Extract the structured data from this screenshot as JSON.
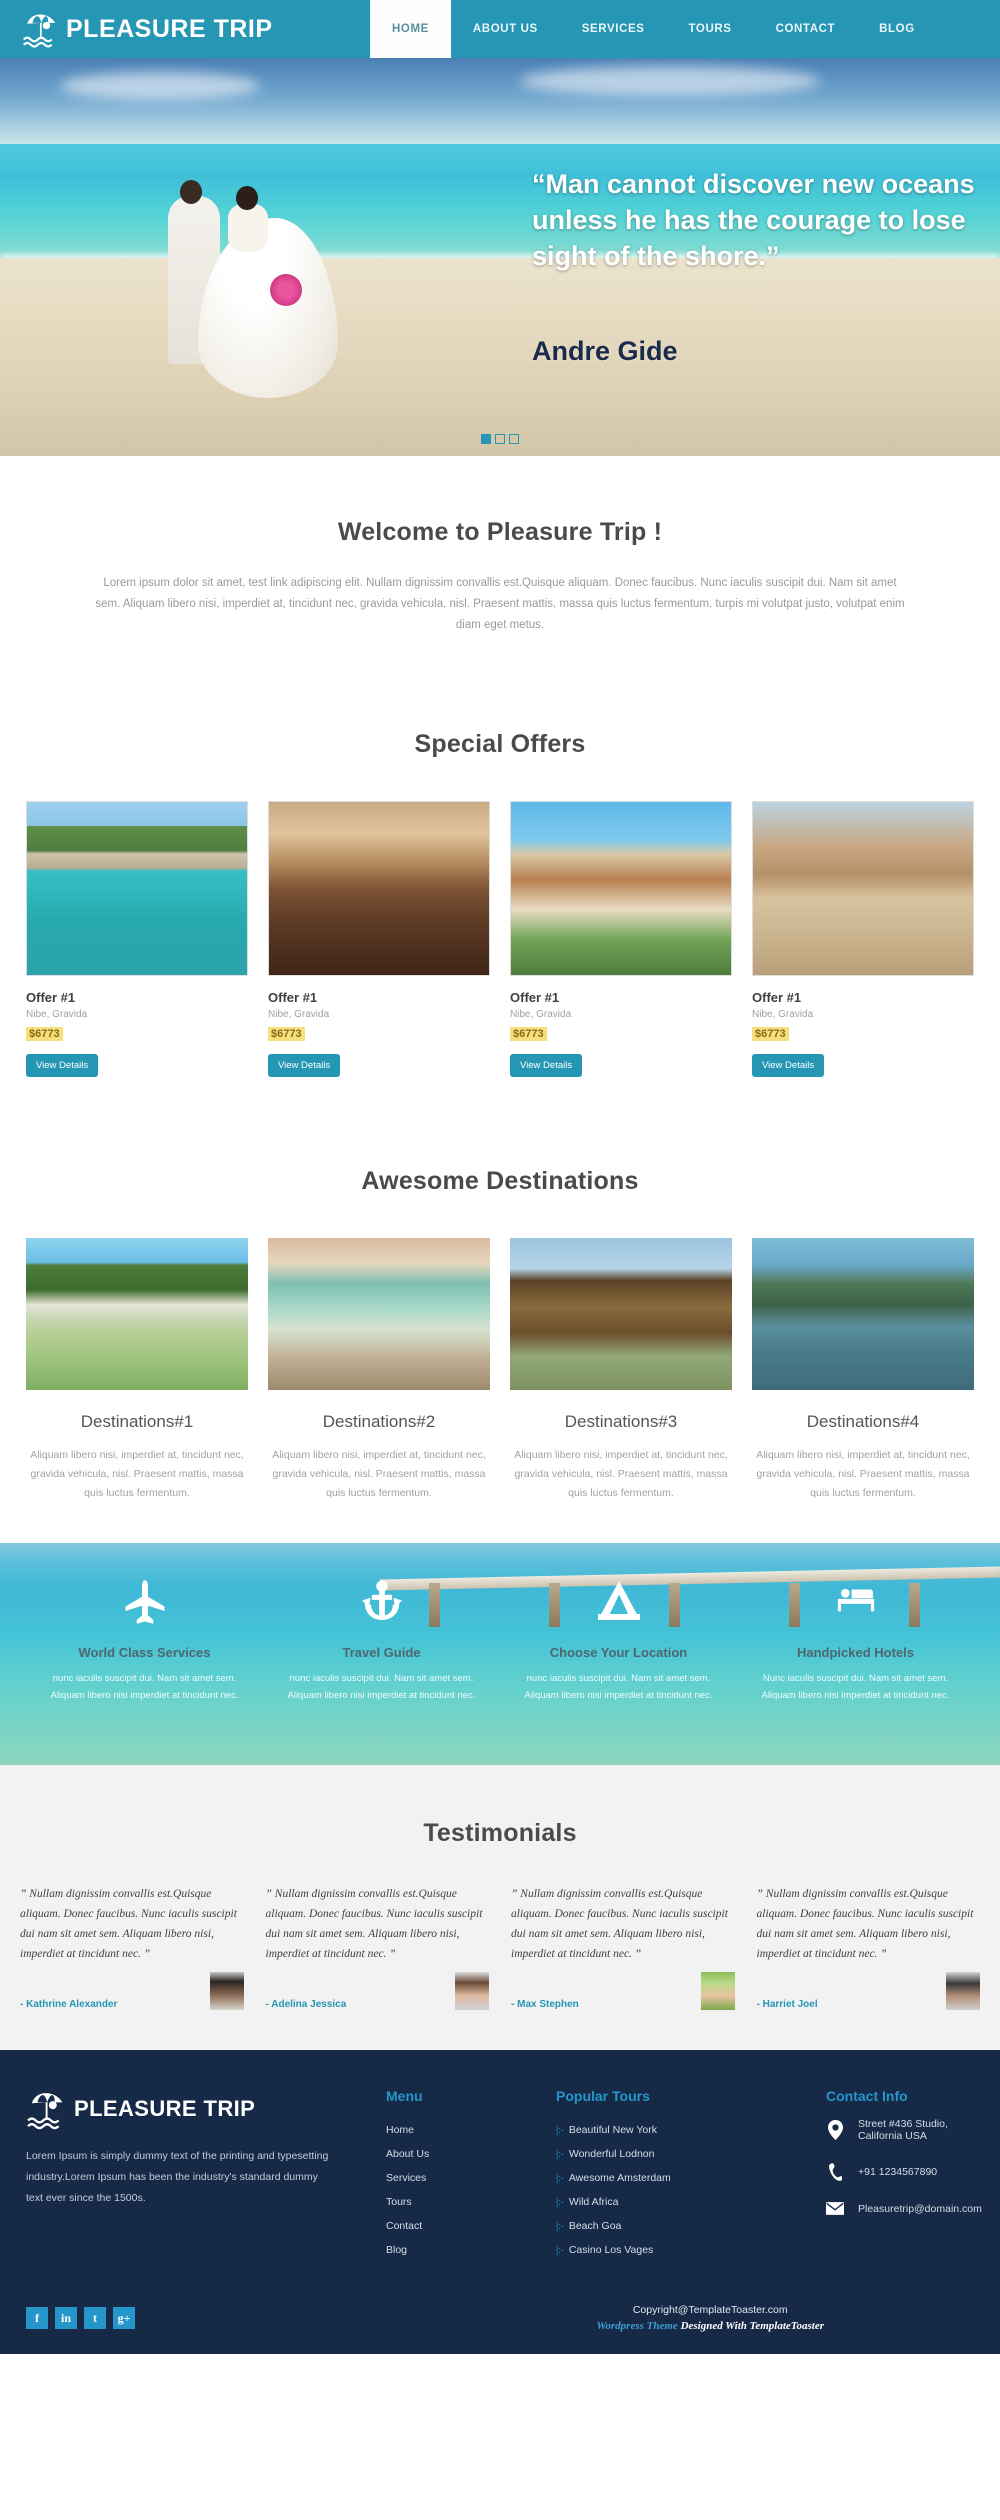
{
  "brand": {
    "name": "PLEASURE TRIP",
    "logo_icon": "beach-umbrella-icon"
  },
  "nav": {
    "items": [
      {
        "label": "HOME",
        "active": true
      },
      {
        "label": "ABOUT US",
        "active": false
      },
      {
        "label": "SERVICES",
        "active": false
      },
      {
        "label": "TOURS",
        "active": false
      },
      {
        "label": "CONTACT",
        "active": false
      },
      {
        "label": "BLOG",
        "active": false
      }
    ]
  },
  "hero": {
    "quote": "“Man cannot discover new oceans unless he has the courage to lose sight of the shore.”",
    "author": "Andre Gide",
    "slides": [
      {
        "active": true
      },
      {
        "active": false
      },
      {
        "active": false
      }
    ]
  },
  "welcome": {
    "title": "Welcome to Pleasure Trip !",
    "text": "Lorem ipsum dolor sit amet, test link adipiscing elit. Nullam dignissim convallis est.Quisque aliquam. Donec faucibus. Nunc iaculis suscipit dui. Nam sit amet sem. Aliquam libero nisi, imperdiet at, tincidunt nec, gravida vehicula, nisl. Praesent mattis, massa quis luctus fermentum, turpis mi volutpat justo, volutpat enim diam eget metus."
  },
  "offers": {
    "title": "Special Offers",
    "button_label": "View Details",
    "items": [
      {
        "title": "Offer #1",
        "subtitle": "Nibe, Gravida",
        "price": "$6773",
        "image": "img-kayaks"
      },
      {
        "title": "Offer #1",
        "subtitle": "Nibe, Gravida",
        "price": "$6773",
        "image": "img-restaurant"
      },
      {
        "title": "Offer #1",
        "subtitle": "Nibe, Gravida",
        "price": "$6773",
        "image": "img-resort"
      },
      {
        "title": "Offer #1",
        "subtitle": "Nibe, Gravida",
        "price": "$6773",
        "image": "img-desert"
      }
    ]
  },
  "destinations": {
    "title": "Awesome Destinations",
    "items": [
      {
        "title": "Destinations#1",
        "text": "Aliquam libero nisi, imperdiet at, tincidunt nec, gravida vehicula, nisl. Praesent mattis, massa quis luctus fermentum.",
        "image": "img-van"
      },
      {
        "title": "Destinations#2",
        "text": "Aliquam libero nisi, imperdiet at, tincidunt nec, gravida vehicula, nisl. Praesent mattis, massa quis luctus fermentum.",
        "image": "img-bedroom"
      },
      {
        "title": "Destinations#3",
        "text": "Aliquam libero nisi, imperdiet at, tincidunt nec, gravida vehicula, nisl. Praesent mattis, massa quis luctus fermentum.",
        "image": "img-sphere"
      },
      {
        "title": "Destinations#4",
        "text": "Aliquam libero nisi, imperdiet at, tincidunt nec, gravida vehicula, nisl. Praesent mattis, massa quis luctus fermentum.",
        "image": "img-lake"
      }
    ]
  },
  "features": {
    "items": [
      {
        "icon": "airplane-icon",
        "title": "World Class Services",
        "text": "nunc iaculis suscipit dui. Nam sit amet sem. Aliquam libero nisi imperdiet at tincidunt nec."
      },
      {
        "icon": "anchor-icon",
        "title": "Travel Guide",
        "text": "nunc iaculis suscipit dui. Nam sit amet sem. Aliquam libero nisi imperdiet at tincidunt nec."
      },
      {
        "icon": "tent-icon",
        "title": "Choose Your Location",
        "text": "nunc iaculis suscipit dui. Nam sit amet sem. Aliquam libero nisi imperdiet at tincidunt nec."
      },
      {
        "icon": "bed-icon",
        "title": "Handpicked Hotels",
        "text": "Nunc iaculis suscipit dui. Nam sit amet sem. Aliquam libero nisi imperdiet at tincidunt nec."
      }
    ]
  },
  "testimonials": {
    "title": "Testimonials",
    "items": [
      {
        "quote": "” Nullam dignissim convallis est.Quisque aliquam. Donec faucibus. Nunc iaculis suscipit dui nam sit amet sem. Aliquam libero nisi, imperdiet at tincidunt nec. ”",
        "author": "- Kathrine Alexander",
        "avatar": "av1"
      },
      {
        "quote": "” Nullam dignissim convallis est.Quisque aliquam. Donec faucibus. Nunc iaculis suscipit dui nam sit amet sem. Aliquam libero nisi, imperdiet at tincidunt nec. ”",
        "author": "- Adelina Jessica",
        "avatar": "av2"
      },
      {
        "quote": "” Nullam dignissim convallis est.Quisque aliquam. Donec faucibus. Nunc iaculis suscipit dui nam sit amet sem. Aliquam libero nisi, imperdiet at tincidunt nec. ”",
        "author": "- Max Stephen",
        "avatar": "av3"
      },
      {
        "quote": "” Nullam dignissim convallis est.Quisque aliquam. Donec faucibus. Nunc iaculis suscipit dui nam sit amet sem. Aliquam libero nisi, imperdiet at tincidunt nec. ”",
        "author": "- Harriet Joel",
        "avatar": "av4"
      }
    ]
  },
  "footer": {
    "description": "Lorem Ipsum is simply dummy text of the printing and typesetting industry.Lorem Ipsum has been the industry's standard dummy text ever since the 1500s.",
    "menu": {
      "heading": "Menu",
      "items": [
        {
          "label": "Home"
        },
        {
          "label": "About Us"
        },
        {
          "label": "Services"
        },
        {
          "label": "Tours"
        },
        {
          "label": "Contact"
        },
        {
          "label": "Blog"
        }
      ]
    },
    "tours": {
      "heading": "Popular Tours",
      "bullet": "|:-",
      "items": [
        {
          "label": "Beautiful New York"
        },
        {
          "label": "Wonderful Lodnon"
        },
        {
          "label": "Awesome Amsterdam"
        },
        {
          "label": "Wild Africa"
        },
        {
          "label": "Beach Goa"
        },
        {
          "label": "Casino Los Vages"
        }
      ]
    },
    "contact": {
      "heading": "Contact Info",
      "items": [
        {
          "icon": "location-pin-icon",
          "text": "Street #436 Studio, California USA"
        },
        {
          "icon": "phone-icon",
          "text": "+91 1234567890"
        },
        {
          "icon": "envelope-icon",
          "text": "Pleasuretrip@domain.com"
        }
      ]
    },
    "socials": [
      {
        "icon": "facebook-icon",
        "glyph": "f"
      },
      {
        "icon": "linkedin-icon",
        "glyph": "in"
      },
      {
        "icon": "twitter-icon",
        "glyph": "t"
      },
      {
        "icon": "google-plus-icon",
        "glyph": "g+"
      }
    ],
    "copyright": "Copyright@TemplateToaster.com",
    "designed_prefix": "Wordpress Theme",
    "designed_suffix": " Designed With TemplateToaster"
  },
  "colors": {
    "brand_teal": "#2596b4",
    "footer_navy": "#162a47",
    "price_highlight": "#f6e07c",
    "accent_link": "#2596c9"
  }
}
